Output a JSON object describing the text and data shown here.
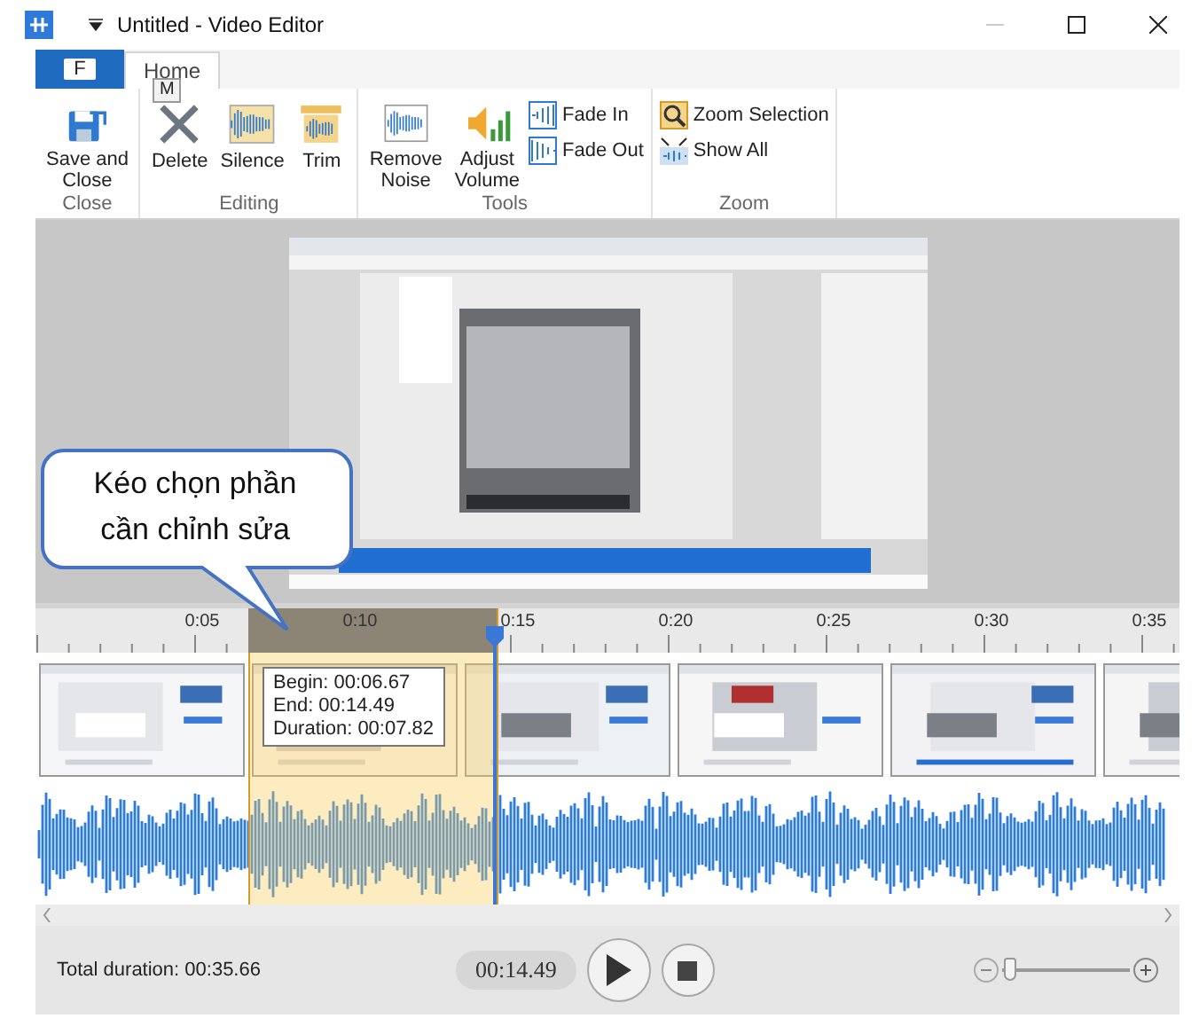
{
  "window": {
    "title": "Untitled - Video Editor"
  },
  "ribbon": {
    "file_tab": {
      "label": "F"
    },
    "tabs": [
      {
        "label": "Home",
        "selected": true
      }
    ],
    "keytip": "M",
    "groups": [
      {
        "name": "Close",
        "buttons": [
          {
            "label": "Save and\nClose",
            "kind": "large"
          }
        ]
      },
      {
        "name": "Editing",
        "buttons": [
          {
            "label": "Delete",
            "kind": "large"
          },
          {
            "label": "Silence",
            "kind": "large"
          },
          {
            "label": "Trim",
            "kind": "large"
          }
        ]
      },
      {
        "name": "Tools",
        "buttons": [
          {
            "label": "Remove\nNoise",
            "kind": "large"
          },
          {
            "label": "Adjust\nVolume",
            "kind": "large"
          },
          {
            "label": "Fade In",
            "kind": "small"
          },
          {
            "label": "Fade Out",
            "kind": "small"
          }
        ]
      },
      {
        "name": "Zoom",
        "buttons": [
          {
            "label": "Zoom Selection",
            "kind": "small"
          },
          {
            "label": "Show All",
            "kind": "small"
          }
        ]
      }
    ]
  },
  "preview": {
    "kind": "picture"
  },
  "callout": {
    "text": "Kéo chọn phần\ncần chỉnh sửa"
  },
  "timeline": {
    "ticks": [
      "0:05",
      "0:10",
      "0:15",
      "0:20",
      "0:25",
      "0:30",
      "0:35"
    ],
    "thumbnails": [
      {
        "kind": "picture"
      },
      {
        "kind": "picture"
      },
      {
        "kind": "picture"
      },
      {
        "kind": "picture"
      },
      {
        "kind": "picture"
      },
      {
        "kind": "picture"
      }
    ],
    "tooltip": [
      "Begin: 00:06.67",
      "End: 00:14.49",
      "Duration: 00:07.82"
    ]
  },
  "status_bar": {
    "total_duration": "Total duration: 00:35.66",
    "time": "00:14.49",
    "zoom": {
      "level": 0.05
    }
  }
}
